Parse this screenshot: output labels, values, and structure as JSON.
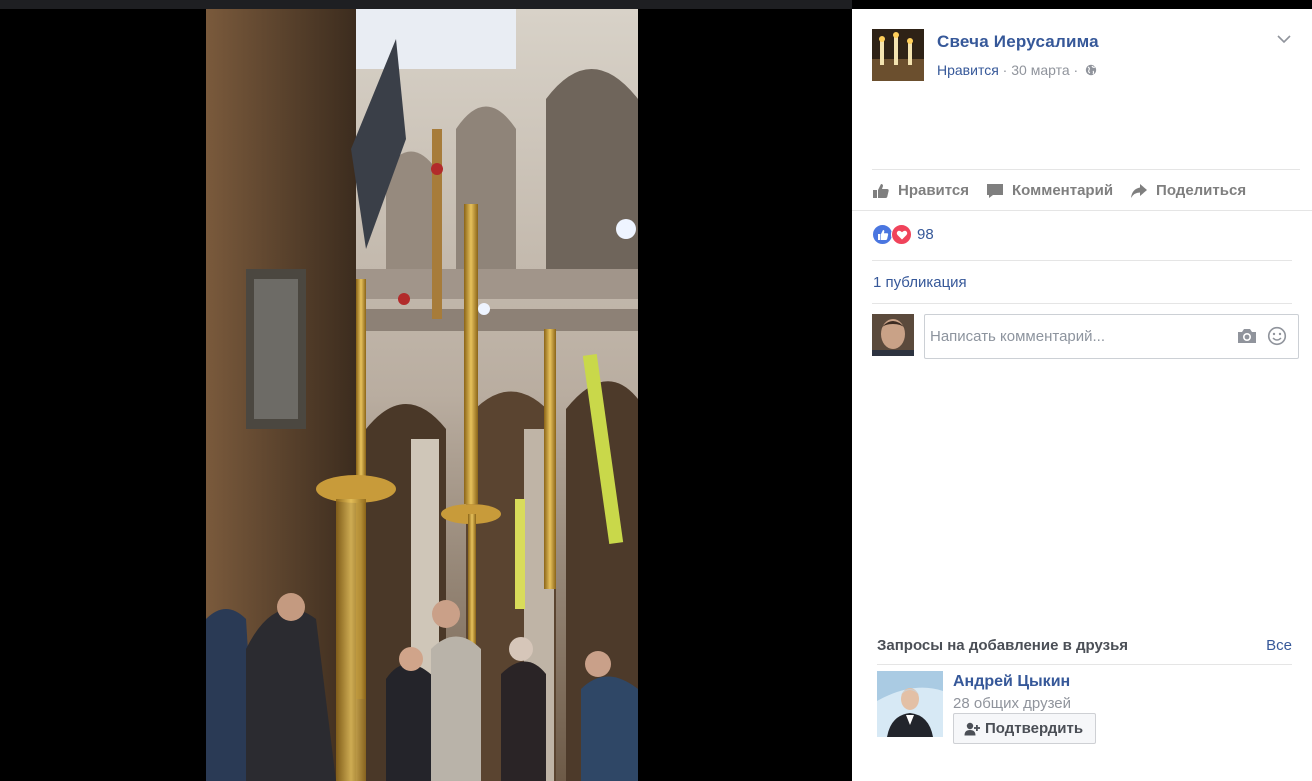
{
  "post": {
    "page_name": "Свеча Иерусалима",
    "like_label": "Нравится",
    "separator": "·",
    "date": "30 марта",
    "privacy_icon": "globe-icon"
  },
  "actions": {
    "like": "Нравится",
    "comment": "Комментарий",
    "share": "Поделиться"
  },
  "reactions": {
    "types": [
      "like",
      "love"
    ],
    "count": "98"
  },
  "shares": "1 публикация",
  "comment": {
    "placeholder": "Написать комментарий..."
  },
  "friend_requests": {
    "title": "Запросы на добавление в друзья",
    "all_label": "Все",
    "items": [
      {
        "name": "Андрей Цыкин",
        "mutual": "28 общих друзей",
        "confirm_label": "Подтвердить"
      }
    ]
  },
  "colors": {
    "link": "#365899",
    "muted": "#90949c",
    "action": "#7f7f7f",
    "like_blue": "#4a76e0",
    "love_red": "#f0435b",
    "viewer_bg": "#000000"
  }
}
